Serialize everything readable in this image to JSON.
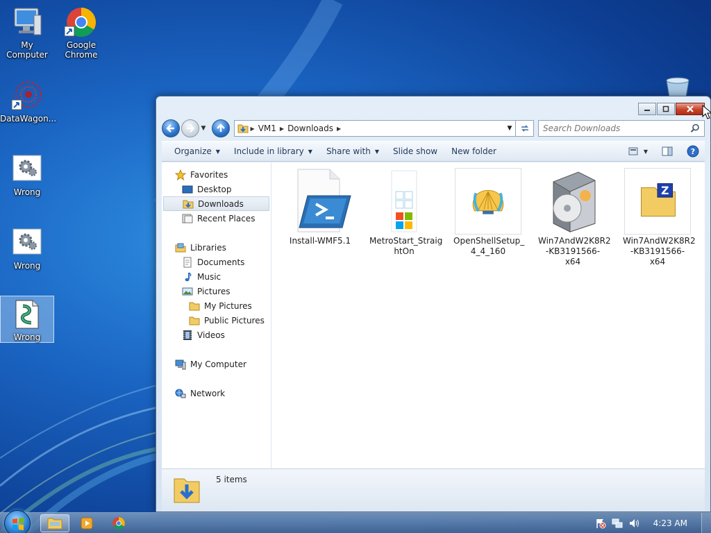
{
  "desktop": {
    "icons": [
      {
        "label": "My Computer"
      },
      {
        "label": "Google Chrome"
      },
      {
        "label": "DataWagon..."
      },
      {
        "label": "Wrong"
      },
      {
        "label": "Wrong"
      },
      {
        "label": "Wrong"
      }
    ]
  },
  "explorer": {
    "address": {
      "crumbs": [
        "VM1",
        "Downloads"
      ]
    },
    "search": {
      "placeholder": "Search Downloads"
    },
    "toolbar": {
      "organize": "Organize",
      "include_in_library": "Include in library",
      "share_with": "Share with",
      "slide_show": "Slide show",
      "new_folder": "New folder"
    },
    "nav_pane": {
      "favorites": "Favorites",
      "desktop": "Desktop",
      "downloads": "Downloads",
      "recent_places": "Recent Places",
      "libraries": "Libraries",
      "documents": "Documents",
      "music": "Music",
      "pictures": "Pictures",
      "my_pictures": "My Pictures",
      "public_pictures": "Public Pictures",
      "videos": "Videos",
      "my_computer": "My Computer",
      "network": "Network"
    },
    "files": [
      {
        "name_line1": "Install-WMF5.1",
        "name_line2": ""
      },
      {
        "name_line1": "MetroStart_Straig",
        "name_line2": "htOn"
      },
      {
        "name_line1": "OpenShellSetup_",
        "name_line2": "4_4_160"
      },
      {
        "name_line1": "Win7AndW2K8R2",
        "name_line2": "-KB3191566-x64"
      },
      {
        "name_line1": "Win7AndW2K8R2",
        "name_line2": "-KB3191566-x64"
      }
    ],
    "status": {
      "item_count": "5 items"
    }
  },
  "taskbar": {
    "clock": "4:23 AM"
  },
  "colors": {
    "desktop_blue": "#1b66c4",
    "window_frame": "#d6e3f1",
    "close_red": "#c7432a",
    "toolbar_text": "#1e395b"
  }
}
